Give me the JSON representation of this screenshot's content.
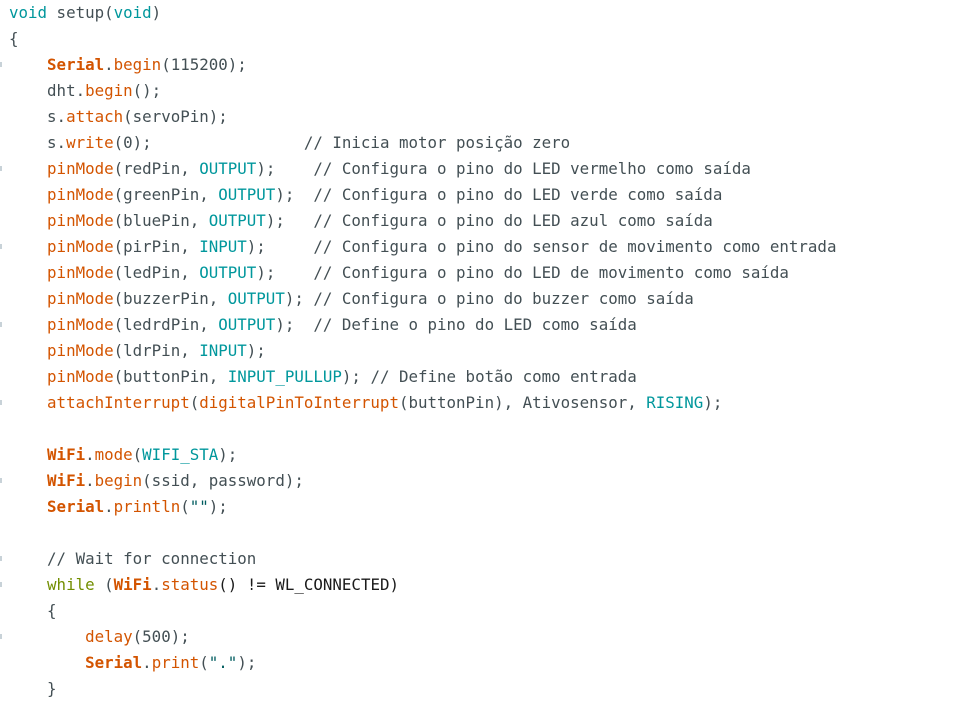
{
  "editor": {
    "colors": {
      "type": "#00979c",
      "control": "#728e00",
      "function": "#d35400",
      "constant": "#00979c",
      "class": "#d35400",
      "comment": "#434f54",
      "string": "#005c5f",
      "plain": "#434f54",
      "background": "#ffffff"
    },
    "lines": [
      [
        {
          "t": "void",
          "c": "type"
        },
        {
          "t": " setup(",
          "c": "plain"
        },
        {
          "t": "void",
          "c": "type"
        },
        {
          "t": ")",
          "c": "plain"
        }
      ],
      [
        {
          "t": "{",
          "c": "plain"
        }
      ],
      [
        {
          "t": "    ",
          "c": "plain"
        },
        {
          "t": "Serial",
          "c": "class"
        },
        {
          "t": ".",
          "c": "plain"
        },
        {
          "t": "begin",
          "c": "func"
        },
        {
          "t": "(115200);",
          "c": "plain"
        }
      ],
      [
        {
          "t": "    dht.",
          "c": "plain"
        },
        {
          "t": "begin",
          "c": "func"
        },
        {
          "t": "();",
          "c": "plain"
        }
      ],
      [
        {
          "t": "    s.",
          "c": "plain"
        },
        {
          "t": "attach",
          "c": "func"
        },
        {
          "t": "(servoPin);",
          "c": "plain"
        }
      ],
      [
        {
          "t": "    s.",
          "c": "plain"
        },
        {
          "t": "write",
          "c": "func"
        },
        {
          "t": "(0);                ",
          "c": "plain"
        },
        {
          "t": "// Inicia motor posição zero",
          "c": "com"
        }
      ],
      [
        {
          "t": "    ",
          "c": "plain"
        },
        {
          "t": "pinMode",
          "c": "func"
        },
        {
          "t": "(redPin, ",
          "c": "plain"
        },
        {
          "t": "OUTPUT",
          "c": "const"
        },
        {
          "t": ");    ",
          "c": "plain"
        },
        {
          "t": "// Configura o pino do LED vermelho como saída",
          "c": "com"
        }
      ],
      [
        {
          "t": "    ",
          "c": "plain"
        },
        {
          "t": "pinMode",
          "c": "func"
        },
        {
          "t": "(greenPin, ",
          "c": "plain"
        },
        {
          "t": "OUTPUT",
          "c": "const"
        },
        {
          "t": ");  ",
          "c": "plain"
        },
        {
          "t": "// Configura o pino do LED verde como saída",
          "c": "com"
        }
      ],
      [
        {
          "t": "    ",
          "c": "plain"
        },
        {
          "t": "pinMode",
          "c": "func"
        },
        {
          "t": "(bluePin, ",
          "c": "plain"
        },
        {
          "t": "OUTPUT",
          "c": "const"
        },
        {
          "t": ");   ",
          "c": "plain"
        },
        {
          "t": "// Configura o pino do LED azul como saída",
          "c": "com"
        }
      ],
      [
        {
          "t": "    ",
          "c": "plain"
        },
        {
          "t": "pinMode",
          "c": "func"
        },
        {
          "t": "(pirPin, ",
          "c": "plain"
        },
        {
          "t": "INPUT",
          "c": "const"
        },
        {
          "t": ");     ",
          "c": "plain"
        },
        {
          "t": "// Configura o pino do sensor de movimento como entrada",
          "c": "com"
        }
      ],
      [
        {
          "t": "    ",
          "c": "plain"
        },
        {
          "t": "pinMode",
          "c": "func"
        },
        {
          "t": "(ledPin, ",
          "c": "plain"
        },
        {
          "t": "OUTPUT",
          "c": "const"
        },
        {
          "t": ");    ",
          "c": "plain"
        },
        {
          "t": "// Configura o pino do LED de movimento como saída",
          "c": "com"
        }
      ],
      [
        {
          "t": "    ",
          "c": "plain"
        },
        {
          "t": "pinMode",
          "c": "func"
        },
        {
          "t": "(buzzerPin, ",
          "c": "plain"
        },
        {
          "t": "OUTPUT",
          "c": "const"
        },
        {
          "t": "); ",
          "c": "plain"
        },
        {
          "t": "// Configura o pino do buzzer como saída",
          "c": "com"
        }
      ],
      [
        {
          "t": "    ",
          "c": "plain"
        },
        {
          "t": "pinMode",
          "c": "func"
        },
        {
          "t": "(ledrdPin, ",
          "c": "plain"
        },
        {
          "t": "OUTPUT",
          "c": "const"
        },
        {
          "t": ");  ",
          "c": "plain"
        },
        {
          "t": "// Define o pino do LED como saída",
          "c": "com"
        }
      ],
      [
        {
          "t": "    ",
          "c": "plain"
        },
        {
          "t": "pinMode",
          "c": "func"
        },
        {
          "t": "(ldrPin, ",
          "c": "plain"
        },
        {
          "t": "INPUT",
          "c": "const"
        },
        {
          "t": ");",
          "c": "plain"
        }
      ],
      [
        {
          "t": "    ",
          "c": "plain"
        },
        {
          "t": "pinMode",
          "c": "func"
        },
        {
          "t": "(buttonPin, ",
          "c": "plain"
        },
        {
          "t": "INPUT_PULLUP",
          "c": "const"
        },
        {
          "t": "); ",
          "c": "plain"
        },
        {
          "t": "// Define botão como entrada",
          "c": "com"
        }
      ],
      [
        {
          "t": "    ",
          "c": "plain"
        },
        {
          "t": "attachInterrupt",
          "c": "func"
        },
        {
          "t": "(",
          "c": "plain"
        },
        {
          "t": "digitalPinToInterrupt",
          "c": "func"
        },
        {
          "t": "(buttonPin), Ativosensor, ",
          "c": "plain"
        },
        {
          "t": "RISING",
          "c": "const"
        },
        {
          "t": ");",
          "c": "plain"
        }
      ],
      [],
      [
        {
          "t": "    ",
          "c": "plain"
        },
        {
          "t": "WiFi",
          "c": "class"
        },
        {
          "t": ".",
          "c": "plain"
        },
        {
          "t": "mode",
          "c": "func"
        },
        {
          "t": "(",
          "c": "plain"
        },
        {
          "t": "WIFI_STA",
          "c": "const"
        },
        {
          "t": ");",
          "c": "plain"
        }
      ],
      [
        {
          "t": "    ",
          "c": "plain"
        },
        {
          "t": "WiFi",
          "c": "class"
        },
        {
          "t": ".",
          "c": "plain"
        },
        {
          "t": "begin",
          "c": "func"
        },
        {
          "t": "(ssid, password);",
          "c": "plain"
        }
      ],
      [
        {
          "t": "    ",
          "c": "plain"
        },
        {
          "t": "Serial",
          "c": "class"
        },
        {
          "t": ".",
          "c": "plain"
        },
        {
          "t": "println",
          "c": "func"
        },
        {
          "t": "(",
          "c": "plain"
        },
        {
          "t": "\"\"",
          "c": "str"
        },
        {
          "t": ");",
          "c": "plain"
        }
      ],
      [],
      [
        {
          "t": "    ",
          "c": "plain"
        },
        {
          "t": "// Wait for connection",
          "c": "com"
        }
      ],
      [
        {
          "t": "    ",
          "c": "plain"
        },
        {
          "t": "while",
          "c": "ctrl"
        },
        {
          "t": " (",
          "c": "plain"
        },
        {
          "t": "WiFi",
          "c": "class"
        },
        {
          "t": ".",
          "c": "plain"
        },
        {
          "t": "status",
          "c": "func"
        },
        {
          "t": "() != WL_CONNECTED)",
          "c": "dark"
        }
      ],
      [
        {
          "t": "    {",
          "c": "plain"
        }
      ],
      [
        {
          "t": "        ",
          "c": "plain"
        },
        {
          "t": "delay",
          "c": "func"
        },
        {
          "t": "(500);",
          "c": "plain"
        }
      ],
      [
        {
          "t": "        ",
          "c": "plain"
        },
        {
          "t": "Serial",
          "c": "class"
        },
        {
          "t": ".",
          "c": "plain"
        },
        {
          "t": "print",
          "c": "func"
        },
        {
          "t": "(",
          "c": "plain"
        },
        {
          "t": "\".\"",
          "c": "str"
        },
        {
          "t": ");",
          "c": "plain"
        }
      ],
      [
        {
          "t": "    }",
          "c": "plain"
        }
      ]
    ]
  }
}
